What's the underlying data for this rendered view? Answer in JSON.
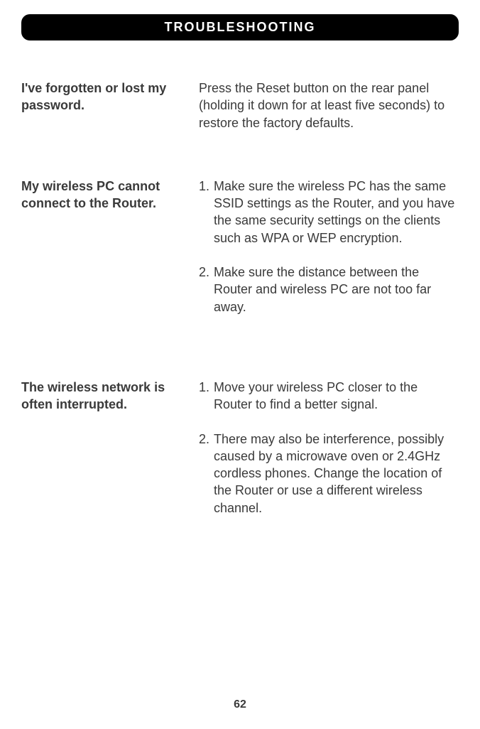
{
  "header": "TROUBLESHOOTING",
  "sections": [
    {
      "problem": "I've forgotten or lost my password.",
      "answer": "Press the Reset button on the rear panel (holding it down for at least five seconds) to restore the factory defaults."
    },
    {
      "problem": "My wireless PC cannot connect to the Router.",
      "steps": [
        {
          "num": "1.",
          "text": "Make sure the wireless PC has the same SSID settings as the Router, and you have the same security settings on the clients such as WPA or WEP encryption."
        },
        {
          "num": "2.",
          "text": "Make sure the distance between the Router and wireless PC are not too far away."
        }
      ]
    },
    {
      "problem": "The wireless network is often interrupted.",
      "steps": [
        {
          "num": "1.",
          "text": "Move your wireless PC closer to the Router to find a better signal."
        },
        {
          "num": "2.",
          "text": "There may also be interference, possibly caused by a microwave oven or 2.4GHz cordless phones. Change the location of the Router or use a different wireless channel."
        }
      ]
    }
  ],
  "pageNumber": "62"
}
